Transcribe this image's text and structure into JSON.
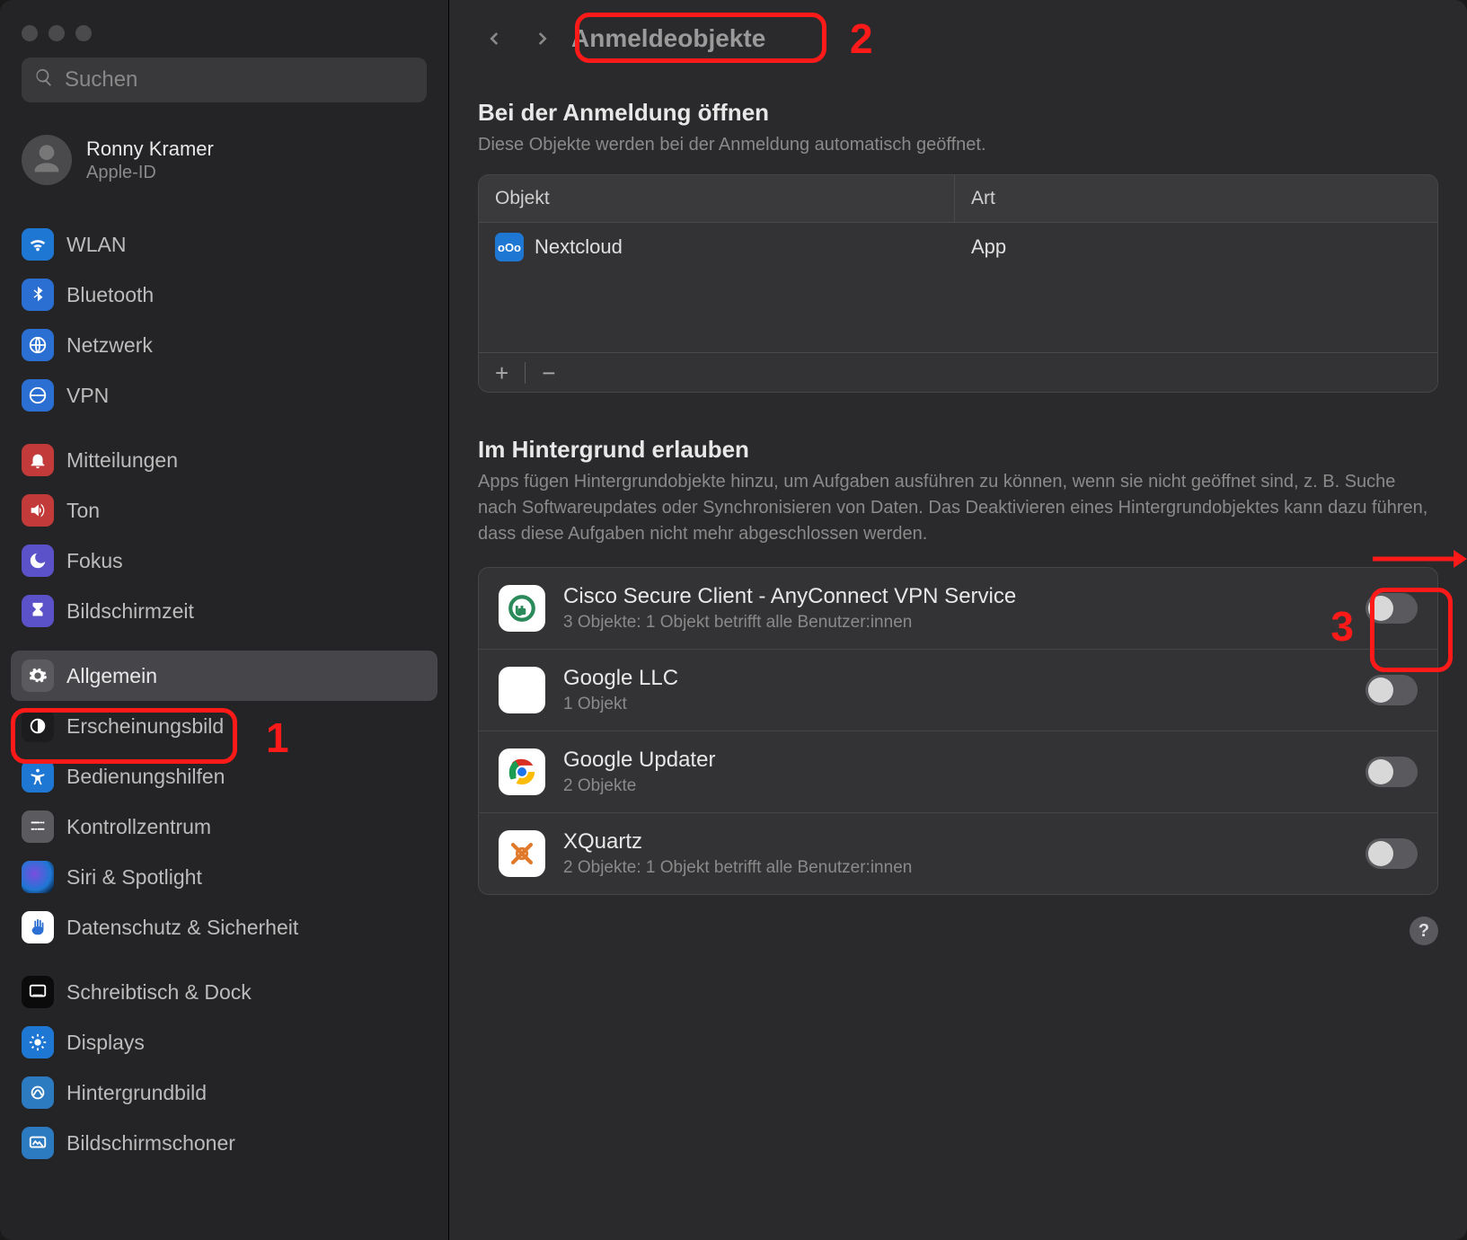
{
  "search": {
    "placeholder": "Suchen"
  },
  "account": {
    "name": "Ronny Kramer",
    "sub": "Apple-ID"
  },
  "sidebar": {
    "groups": [
      [
        {
          "label": "WLAN"
        },
        {
          "label": "Bluetooth"
        },
        {
          "label": "Netzwerk"
        },
        {
          "label": "VPN"
        }
      ],
      [
        {
          "label": "Mitteilungen"
        },
        {
          "label": "Ton"
        },
        {
          "label": "Fokus"
        },
        {
          "label": "Bildschirmzeit"
        }
      ],
      [
        {
          "label": "Allgemein"
        },
        {
          "label": "Erscheinungsbild"
        },
        {
          "label": "Bedienungshilfen"
        },
        {
          "label": "Kontrollzentrum"
        },
        {
          "label": "Siri & Spotlight"
        },
        {
          "label": "Datenschutz & Sicherheit"
        }
      ],
      [
        {
          "label": "Schreibtisch & Dock"
        },
        {
          "label": "Displays"
        },
        {
          "label": "Hintergrundbild"
        },
        {
          "label": "Bildschirmschoner"
        }
      ]
    ]
  },
  "header": {
    "breadcrumb": "Anmeldeobjekte"
  },
  "sections": {
    "open": {
      "title": "Bei der Anmeldung öffnen",
      "desc": "Diese Objekte werden bei der Anmeldung automatisch geöffnet.",
      "columns": {
        "c1": "Objekt",
        "c2": "Art"
      },
      "rows": [
        {
          "name": "Nextcloud",
          "kind": "App"
        }
      ],
      "footer": {
        "add": "+",
        "remove": "−"
      }
    },
    "bg": {
      "title": "Im Hintergrund erlauben",
      "desc": "Apps fügen Hintergrundobjekte hinzu, um Aufgaben ausführen zu können, wenn sie nicht geöffnet sind, z. B. Suche nach Softwareupdates oder Synchronisieren von Daten. Das Deaktivieren eines Hintergrundobjektes kann dazu führen, dass diese Aufgaben nicht mehr abgeschlossen werden.",
      "items": [
        {
          "name": "Cisco Secure Client - AnyConnect VPN Service",
          "sub": "3 Objekte: 1 Objekt betrifft alle Benutzer:innen",
          "on": false
        },
        {
          "name": "Google LLC",
          "sub": "1 Objekt",
          "on": false
        },
        {
          "name": "Google Updater",
          "sub": "2 Objekte",
          "on": false
        },
        {
          "name": "XQuartz",
          "sub": "2 Objekte: 1 Objekt betrifft alle Benutzer:innen",
          "on": false
        }
      ]
    }
  },
  "help": "?",
  "annotations": {
    "a1": "1",
    "a2": "2",
    "a3": "3"
  }
}
